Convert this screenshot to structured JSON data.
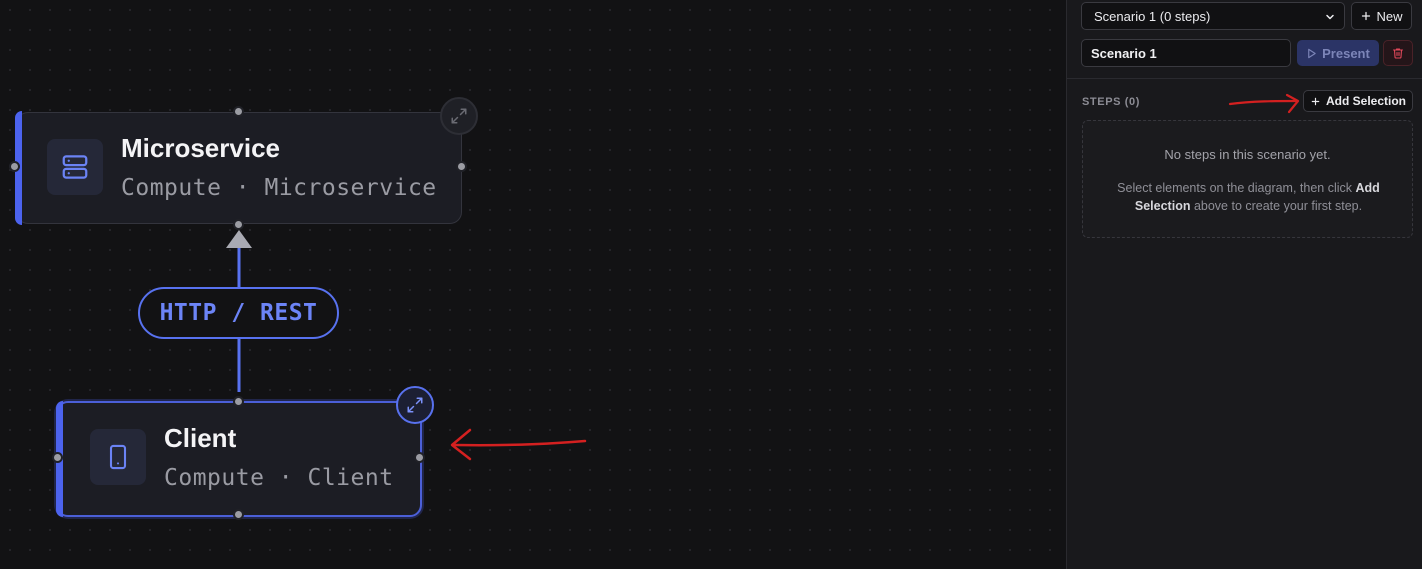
{
  "canvas": {
    "nodes": [
      {
        "title": "Microservice",
        "subtitle": "Compute · Microservice",
        "icon": "server-icon",
        "selected": false
      },
      {
        "title": "Client",
        "subtitle": "Compute · Client",
        "icon": "mobile-device-icon",
        "selected": true
      }
    ],
    "edge": {
      "label": "HTTP / REST",
      "color": "#5872f0"
    },
    "accent_color": "#4c63ee"
  },
  "panel": {
    "scenario_select": {
      "value": "Scenario 1 (0 steps)"
    },
    "new_button": {
      "label": "New",
      "icon": "plus-icon"
    },
    "name_input": {
      "value": "Scenario 1"
    },
    "present_button": {
      "label": "Present",
      "icon": "play-icon",
      "disabled": true
    },
    "delete_button": {
      "icon": "trash-icon"
    },
    "steps": {
      "label": "STEPS (0)",
      "add_selection_label": "Add Selection",
      "empty_title": "No steps in this scenario yet.",
      "empty_desc_1": "Select elements on the diagram, then click ",
      "empty_desc_bold": "Add Selection",
      "empty_desc_2": " above to create your first step."
    }
  },
  "annotations": {
    "arrow_color": "#d42020"
  }
}
